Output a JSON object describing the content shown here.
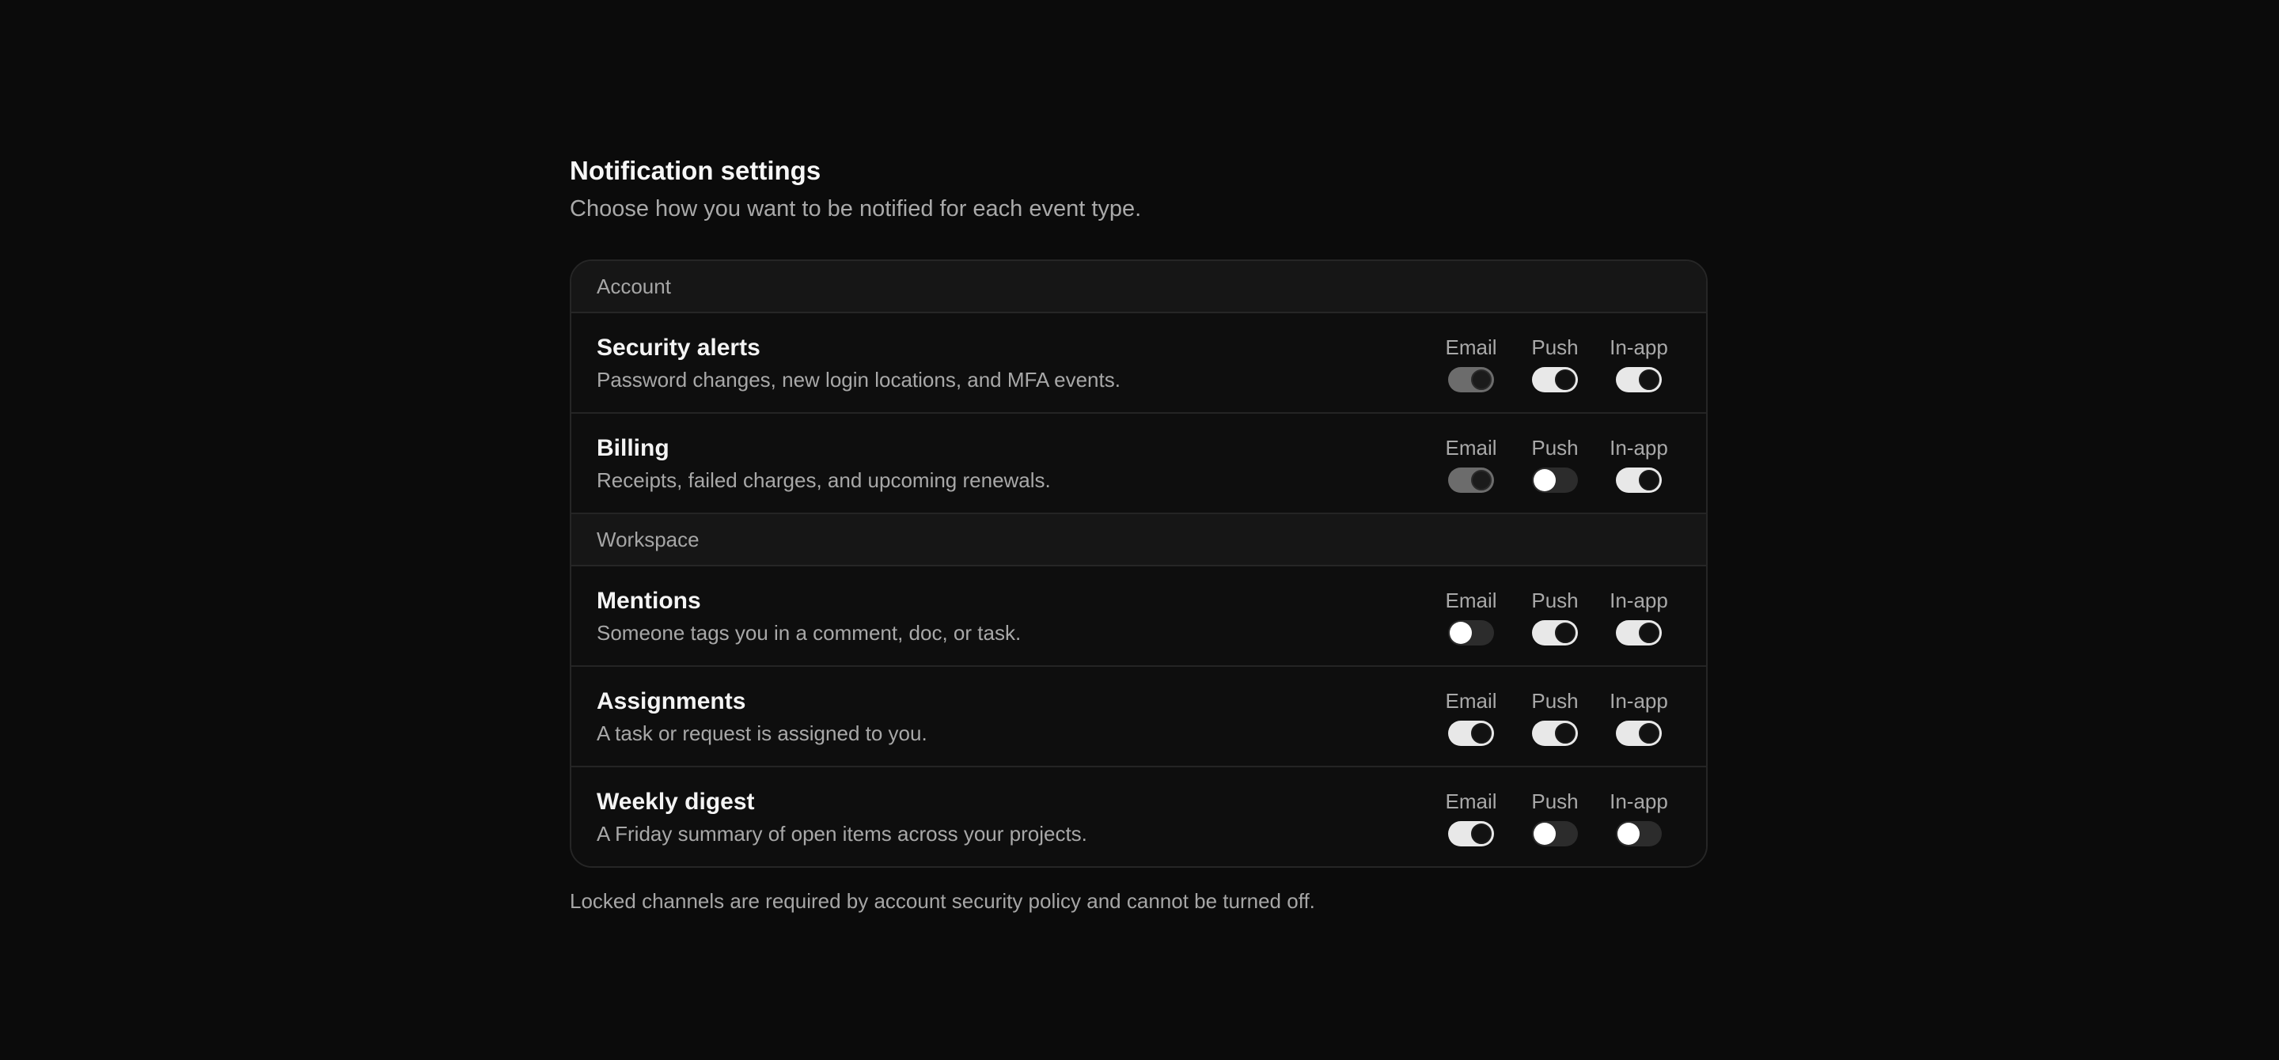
{
  "header": {
    "title": "Notification settings",
    "subtitle": "Choose how you want to be notified for each event type."
  },
  "sections": [
    {
      "label": "Account",
      "rows": [
        {
          "title": "Security alerts",
          "desc": "Password changes, new login locations, and MFA events.",
          "channels": [
            {
              "label": "Email",
              "state": "locked"
            },
            {
              "label": "Push",
              "state": "on"
            },
            {
              "label": "In-app",
              "state": "on"
            }
          ]
        },
        {
          "title": "Billing",
          "desc": "Receipts, failed charges, and upcoming renewals.",
          "channels": [
            {
              "label": "Email",
              "state": "locked"
            },
            {
              "label": "Push",
              "state": "off"
            },
            {
              "label": "In-app",
              "state": "on"
            }
          ]
        }
      ]
    },
    {
      "label": "Workspace",
      "rows": [
        {
          "title": "Mentions",
          "desc": "Someone tags you in a comment, doc, or task.",
          "channels": [
            {
              "label": "Email",
              "state": "off"
            },
            {
              "label": "Push",
              "state": "on"
            },
            {
              "label": "In-app",
              "state": "on"
            }
          ]
        },
        {
          "title": "Assignments",
          "desc": "A task or request is assigned to you.",
          "channels": [
            {
              "label": "Email",
              "state": "on"
            },
            {
              "label": "Push",
              "state": "on"
            },
            {
              "label": "In-app",
              "state": "on"
            }
          ]
        },
        {
          "title": "Weekly digest",
          "desc": "A Friday summary of open items across your projects.",
          "channels": [
            {
              "label": "Email",
              "state": "on"
            },
            {
              "label": "Push",
              "state": "off"
            },
            {
              "label": "In-app",
              "state": "off"
            }
          ]
        }
      ]
    }
  ],
  "footnote": "Locked channels are required by account security policy and cannot be turned off."
}
